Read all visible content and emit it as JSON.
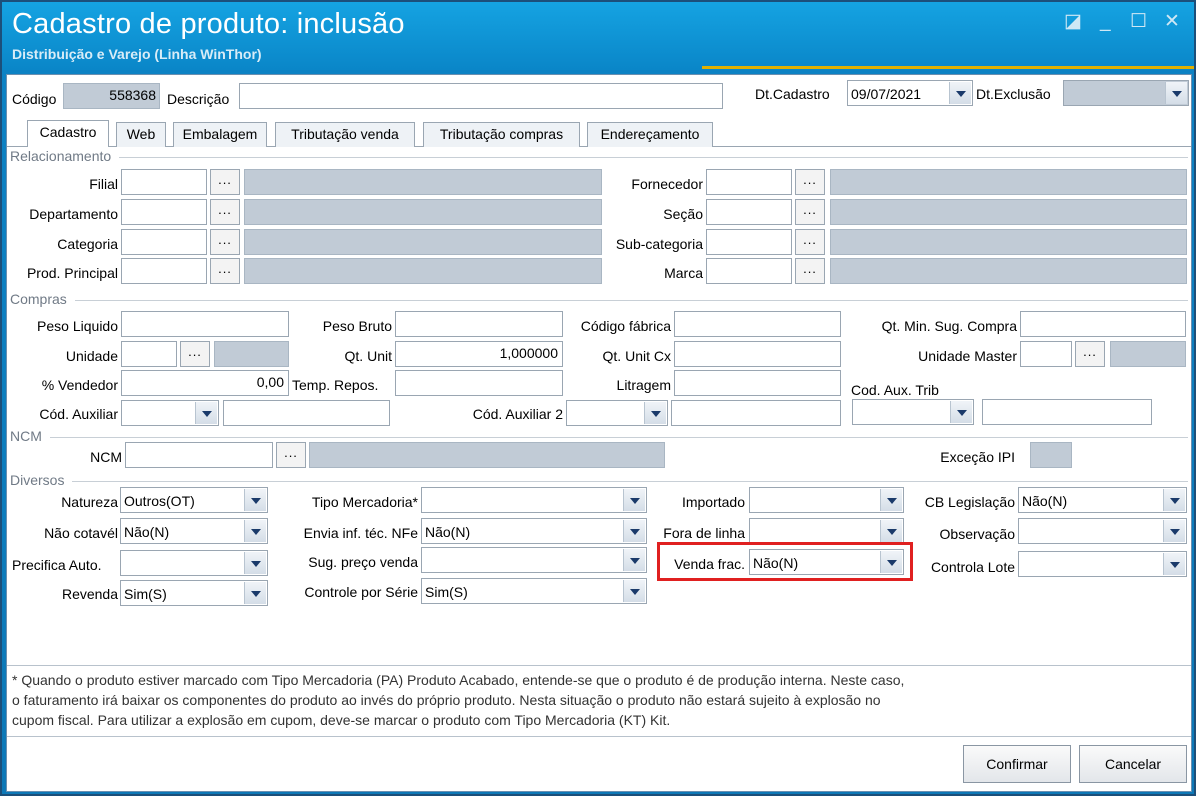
{
  "window": {
    "title": "Cadastro de produto: inclusão",
    "subtitle": "Distribuição e Varejo (Linha WinThor)",
    "controls": {
      "restore": "◪",
      "minimize": "_",
      "maximize": "☐",
      "close": "✕"
    },
    "accent_color": "#0d8ed0"
  },
  "header": {
    "codigo_label": "Código",
    "codigo_value": "558368",
    "descricao_label": "Descrição",
    "descricao_value": "",
    "dt_cadastro_label": "Dt.Cadastro",
    "dt_cadastro_value": "09/07/2021",
    "dt_exclusao_label": "Dt.Exclusão",
    "dt_exclusao_value": ""
  },
  "tabs": [
    "Cadastro",
    "Web",
    "Embalagem",
    "Tributação venda",
    "Tributação compras",
    "Endereçamento"
  ],
  "relacionamento": {
    "title": "Relacionamento",
    "filial": "Filial",
    "departamento": "Departamento",
    "categoria": "Categoria",
    "prod_principal": "Prod. Principal",
    "fornecedor": "Fornecedor",
    "secao": "Seção",
    "sub_categoria": "Sub-categoria",
    "marca": "Marca",
    "ellipsis": "..."
  },
  "compras": {
    "title": "Compras",
    "peso_liquido": "Peso Liquido",
    "peso_bruto": "Peso Bruto",
    "codigo_fabrica": "Código fábrica",
    "qt_min_sug": "Qt. Min. Sug. Compra",
    "unidade": "Unidade",
    "qt_unit": "Qt. Unit",
    "qt_unit_value": "1,000000",
    "qt_unit_cx": "Qt. Unit Cx",
    "unidade_master": "Unidade Master",
    "perc_vendedor": "% Vendedor",
    "perc_vendedor_value": "0,00",
    "temp_repos": "Temp. Repos.",
    "litragem": "Litragem",
    "cod_aux_trib": "Cod. Aux. Trib",
    "cod_auxiliar": "Cód. Auxiliar",
    "cod_auxiliar_2": "Cód. Auxiliar 2"
  },
  "ncm": {
    "title": "NCM",
    "ncm_label": "NCM",
    "excecao_ipi": "Exceção IPI"
  },
  "diversos": {
    "title": "Diversos",
    "natureza": "Natureza",
    "natureza_value": "Outros(OT)",
    "nao_cotavel": "Não cotavél",
    "nao_cotavel_value": "Não(N)",
    "precifica_auto": "Precifica Auto.",
    "revenda": "Revenda",
    "revenda_value": "Sim(S)",
    "tipo_mercadoria": "Tipo Mercadoria*",
    "envia_inf": "Envia inf. téc. NFe",
    "envia_inf_value": "Não(N)",
    "sug_preco": "Sug. preço venda",
    "controle_serie": "Controle por Série",
    "controle_serie_value": "Sim(S)",
    "importado": "Importado",
    "fora_linha": "Fora de linha",
    "venda_frac": "Venda frac.",
    "venda_frac_value": "Não(N)",
    "cb_legislacao": "CB Legislação",
    "cb_legislacao_value": "Não(N)",
    "observacao": "Observação",
    "controla_lote": "Controla Lote"
  },
  "note": {
    "line1": "* Quando o produto estiver marcado com Tipo Mercadoria (PA) Produto Acabado, entende-se que o produto é de produção interna. Neste caso,",
    "line2": "o faturamento irá baixar os componentes do produto ao invés do próprio produto. Nesta situação o produto não estará sujeito à explosão no",
    "line3": "cupom fiscal. Para utilizar a explosão em cupom, deve-se marcar o produto com Tipo Mercadoria (KT) Kit."
  },
  "buttons": {
    "confirmar": "Confirmar",
    "cancelar": "Cancelar"
  },
  "highlight_color": "#e02020"
}
